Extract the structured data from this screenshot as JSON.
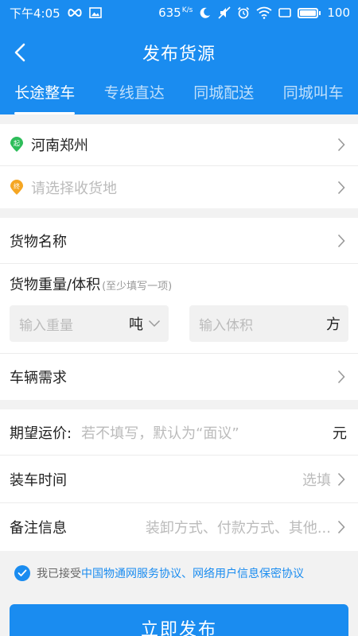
{
  "status": {
    "time": "下午4:05",
    "speed": "635",
    "speed_unit": "K/s",
    "battery": "100"
  },
  "nav": {
    "title": "发布货源"
  },
  "tabs": [
    {
      "label": "长途整车",
      "active": true
    },
    {
      "label": "专线直达",
      "active": false
    },
    {
      "label": "同城配送",
      "active": false
    },
    {
      "label": "同城叫车",
      "active": false
    }
  ],
  "route": {
    "start_badge": "起",
    "start_value": "河南郑州",
    "end_badge": "终",
    "end_placeholder": "请选择收货地"
  },
  "cargo": {
    "name_label": "货物名称",
    "weight_title": "货物重量/体积",
    "weight_hint": "(至少填写一项)",
    "weight_placeholder": "输入重量",
    "weight_unit": "吨",
    "volume_placeholder": "输入体积",
    "volume_unit": "方",
    "vehicle_label": "车辆需求"
  },
  "extra": {
    "price_label": "期望运价:",
    "price_placeholder": "若不填写，默认为“面议”",
    "price_unit": "元",
    "loading_label": "装车时间",
    "loading_placeholder": "选填",
    "remark_label": "备注信息",
    "remark_placeholder": "装卸方式、付款方式、其他..."
  },
  "agreement": {
    "prefix": "我已接受",
    "link": "中国物通网服务协议、网络用户信息保密协议"
  },
  "submit": {
    "label": "立即发布"
  },
  "colors": {
    "primary": "#1a8cf0",
    "start_green": "#2ebd5a",
    "end_orange": "#f5a623"
  }
}
